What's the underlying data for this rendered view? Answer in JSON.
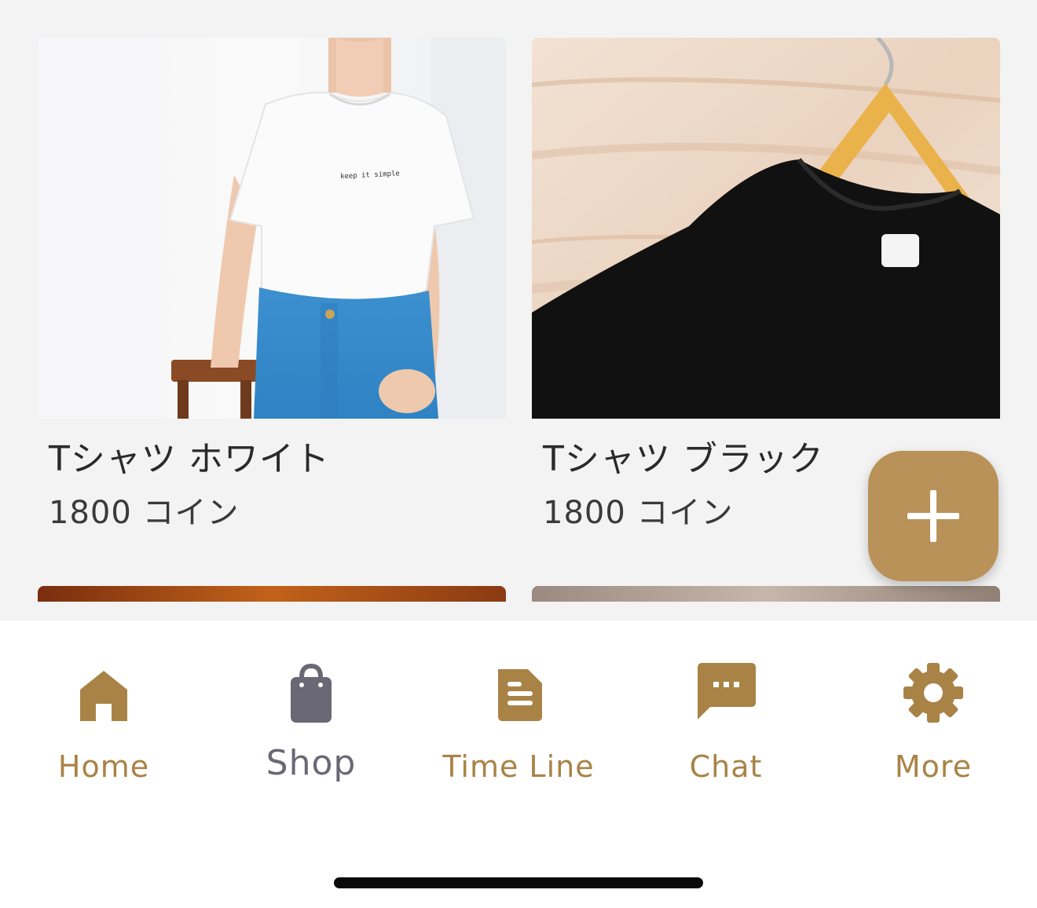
{
  "products": [
    {
      "name": "Tシャツ ホワイト",
      "price": "1800 コイン",
      "image": "white-tshirt-photo"
    },
    {
      "name": "Tシャツ ブラック",
      "price": "1800 コイン",
      "image": "black-tshirt-on-hanger-photo"
    }
  ],
  "fab": {
    "icon": "plus-icon"
  },
  "tabs": [
    {
      "label": "Home",
      "icon": "home-icon",
      "active": false
    },
    {
      "label": "Shop",
      "icon": "shopping-bag-icon",
      "active": true
    },
    {
      "label": "Time Line",
      "icon": "document-icon",
      "active": false
    },
    {
      "label": "Chat",
      "icon": "chat-bubble-icon",
      "active": false
    },
    {
      "label": "More",
      "icon": "gear-icon",
      "active": false
    }
  ],
  "colors": {
    "accent": "#b9925a",
    "tab_inactive": "#a98346",
    "tab_active": "#6a6875",
    "background": "#f3f3f3"
  }
}
